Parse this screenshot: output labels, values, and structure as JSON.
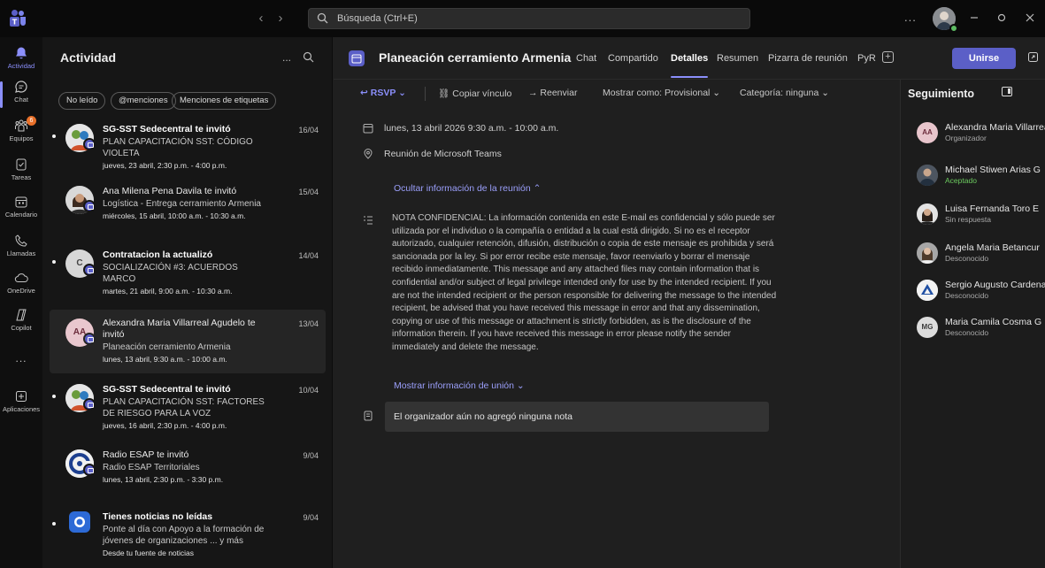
{
  "titlebar": {
    "search_placeholder": "Búsqueda (Ctrl+E)",
    "more": "...",
    "nav_back": "‹",
    "nav_forward": "›"
  },
  "rail": {
    "items": [
      {
        "label": "Actividad",
        "icon": "bell-icon",
        "active": true
      },
      {
        "label": "Chat",
        "icon": "chat-icon",
        "badge": "6"
      },
      {
        "label": "Equipos",
        "icon": "teams-icon"
      },
      {
        "label": "Tareas",
        "icon": "tasks-icon"
      },
      {
        "label": "Calendario",
        "icon": "calendar-icon"
      },
      {
        "label": "Llamadas",
        "icon": "phone-icon"
      },
      {
        "label": "OneDrive",
        "icon": "cloud-icon"
      },
      {
        "label": "Copilot",
        "icon": "copilot-icon"
      },
      {
        "label": "...",
        "icon": "more-icon"
      },
      {
        "label": "Aplicaciones",
        "icon": "add-apps-icon"
      }
    ]
  },
  "activity": {
    "title": "Actividad",
    "more": "...",
    "filters": [
      "No leído",
      "@menciones",
      "Menciones de etiquetas"
    ],
    "items": [
      {
        "name": "SG-SST Sedecentral te invitó",
        "bold": true,
        "subject": "PLAN CAPACITACIÓN SST: CÓDIGO VIOLETA",
        "time": "jueves, 23 abril, 2:30 p.m. - 4:00 p.m.",
        "date": "16/04",
        "unread": true
      },
      {
        "name": "Ana Milena Pena Davila te invitó",
        "bold": false,
        "subject": "Logística - Entrega cerramiento Armenia",
        "time": "miércoles, 15 abril, 10:00 a.m. - 10:30 a.m.",
        "date": "15/04",
        "unread": false
      },
      {
        "name": "Contratacion la actualizó",
        "bold": true,
        "subject": "SOCIALIZACIÓN #3: ACUERDOS MARCO",
        "time": "martes, 21 abril, 9:00 a.m. - 10:30 a.m.",
        "date": "14/04",
        "unread": true,
        "initial": "C"
      },
      {
        "name": "Alexandra Maria Villarreal Agudelo te invitó",
        "bold": false,
        "subject": "Planeación cerramiento Armenia",
        "time": "lunes, 13 abril, 9:30 a.m. - 10:00 a.m.",
        "date": "13/04",
        "unread": false,
        "initial": "AA",
        "selected": true
      },
      {
        "name": "SG-SST Sedecentral te invitó",
        "bold": true,
        "subject": "PLAN CAPACITACIÓN SST: FACTORES DE RIESGO PARA LA VOZ",
        "time": "jueves, 16 abril, 2:30 p.m. - 4:00 p.m.",
        "date": "10/04",
        "unread": true
      },
      {
        "name": "Radio ESAP te invitó",
        "bold": false,
        "subject": "Radio ESAP Territoriales",
        "time": "lunes, 13 abril, 2:30 p.m. - 3:30 p.m.",
        "date": "9/04",
        "unread": false
      },
      {
        "name": "Tienes noticias no leídas",
        "bold": true,
        "subject": "Ponte al día con Apoyo a la formación de jóvenes de organizaciones ... y más",
        "time": "Desde tu fuente de noticias",
        "date": "9/04",
        "unread": true
      }
    ]
  },
  "meeting": {
    "title": "Planeación cerramiento Armenia",
    "tabs": [
      "Chat",
      "Compartido",
      "Detalles",
      "Resumen",
      "Pizarra de reunión",
      "PyR"
    ],
    "active_tab": "Detalles",
    "join_label": "Unirse",
    "toolbar": {
      "rsvp": "RSVP",
      "copy_link": "Copiar vínculo",
      "forward": "Reenviar",
      "show_as": "Mostrar como: Provisional",
      "category": "Categoría: ninguna"
    },
    "datetime": "lunes, 13 abril 2026 9:30 a.m. - 10:00 a.m.",
    "location": "Reunión de Microsoft Teams",
    "hide_info": "Ocultar información de la reunión",
    "notice": "NOTA CONFIDENCIAL: La información contenida en este E-mail es confidencial y sólo puede ser utilizada por el individuo o la compañía o entidad a la cual está dirigido. Si no es el receptor autorizado, cualquier retención, difusión, distribución o copia de este mensaje es prohibida y será sancionada por la ley. Si por error recibe este mensaje, favor reenviarlo y borrar el mensaje recibido inmediatamente. This message and any attached files may contain information that is confidential and/or subject of legal privilege intended only for use by the intended recipient. If you are not the intended recipient or the person responsible for delivering the message to the intended recipient, be advised that you have received this message in error and that any dissemination, copying or use of this message or attachment is strictly forbidden, as is the disclosure of the information therein. If you have received this message in error please notify the sender immediately and delete the message.",
    "show_join": "Mostrar información de unión",
    "notes": "El organizador aún no agregó ninguna nota"
  },
  "tracking": {
    "title": "Seguimiento",
    "people": [
      {
        "name": "Alexandra Maria Villarreal Agudelo",
        "status": "Organizador",
        "initials": "AA"
      },
      {
        "name": "Michael Stiwen Arias G",
        "status": "Aceptado"
      },
      {
        "name": "Luisa Fernanda Toro E",
        "status": "Sin respuesta"
      },
      {
        "name": "Angela Maria Betancur",
        "status": "Desconocido"
      },
      {
        "name": "Sergio Augusto Cardenas",
        "status": "Desconocido"
      },
      {
        "name": "Maria Camila Cosma G",
        "status": "Desconocido",
        "initials": "MG"
      }
    ]
  },
  "colors": {
    "accent": "#5b5fc7",
    "accent_light": "#8b8ffb",
    "accepted": "#6ccb5f",
    "badge": "#e8702a"
  }
}
